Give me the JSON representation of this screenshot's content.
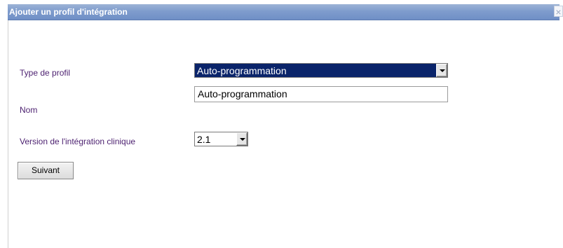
{
  "dialog": {
    "title": "Ajouter un profil d'intégration",
    "close_glyph": "×"
  },
  "form": {
    "profile_type": {
      "label": "Type de profil",
      "value": "Auto-programmation"
    },
    "name": {
      "label": "Nom",
      "value": "Auto-programmation"
    },
    "version": {
      "label": "Version de l'intégration clinique",
      "value": "2.1"
    },
    "next_button_label": "Suivant"
  },
  "colors": {
    "titlebar": "#7f9ccd",
    "label_text": "#4b1f6f",
    "selection": "#0a246a"
  }
}
